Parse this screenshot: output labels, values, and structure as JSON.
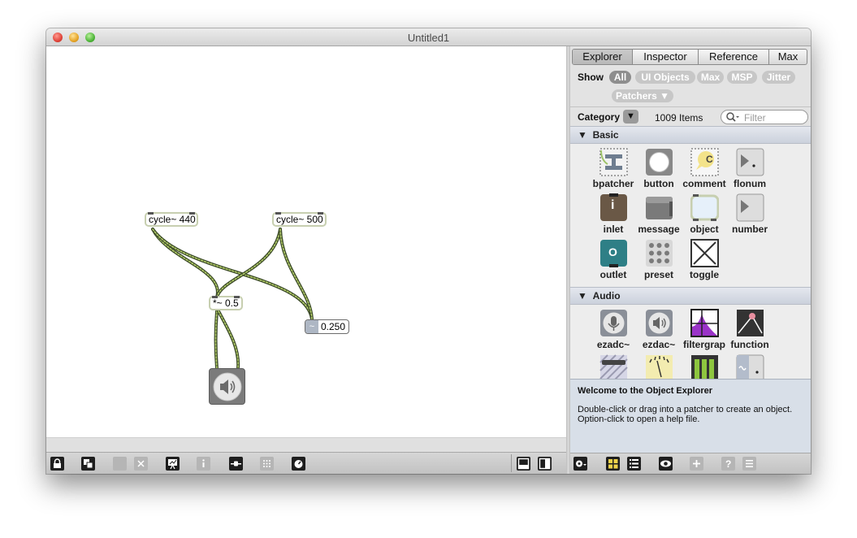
{
  "window": {
    "title": "Untitled1"
  },
  "patcher": {
    "objects": [
      {
        "text": "cycle~ 440"
      },
      {
        "text": "cycle~ 500"
      },
      {
        "text": "*~ 0.5"
      }
    ],
    "number_box": {
      "icon": "~",
      "value": "0.250"
    },
    "ezdac_icon": "speaker-icon"
  },
  "toolbar": {
    "left_icons": [
      "lock-icon",
      "new-view-icon",
      "patch-cords-icon",
      "delete-icon",
      "presentation-icon",
      "info-icon",
      "slider-icon",
      "grid-icon",
      "dsp-icon"
    ],
    "right_icons": [
      "single-view-icon",
      "split-view-icon"
    ]
  },
  "explorer": {
    "tabs": [
      "Explorer",
      "Inspector",
      "Reference",
      "Max"
    ],
    "active_tab": "Explorer",
    "show_label": "Show",
    "filters": [
      "All",
      "UI Objects",
      "Max",
      "MSP",
      "Jitter"
    ],
    "patchers_filter": "Patchers ▼",
    "category_label": "Category",
    "category_arrow": "▼",
    "item_count": "1009 Items",
    "filter_placeholder": "Filter",
    "sections": [
      {
        "name": "Basic",
        "items": [
          "bpatcher",
          "button",
          "comment",
          "flonum",
          "inlet",
          "message",
          "object",
          "number",
          "outlet",
          "preset",
          "toggle"
        ]
      },
      {
        "name": "Audio",
        "items": [
          "ezadc~",
          "ezdac~",
          "filtergrap",
          "function"
        ]
      }
    ],
    "welcome_title": "Welcome to the Object Explorer",
    "welcome_lines": [
      "Double-click or drag into a patcher to create an object.",
      "Option-click to open a help file."
    ],
    "comment_glyph": "C",
    "inlet_glyph": "i",
    "outlet_glyph": "O"
  },
  "colors": {
    "cord_dark": "#3e4d2a",
    "cord_light": "#b9d36c",
    "object_border": "#c7cfb0"
  }
}
